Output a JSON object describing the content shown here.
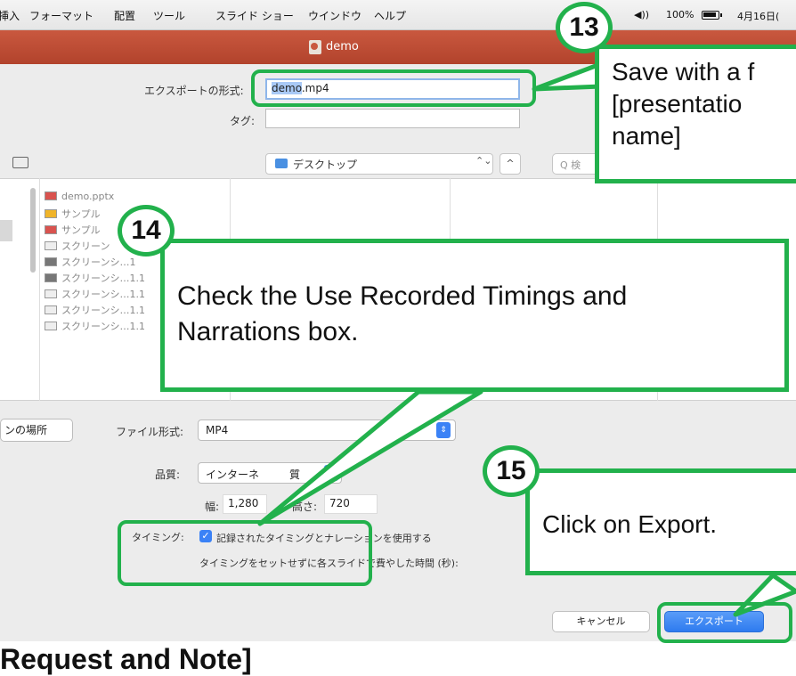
{
  "menubar": {
    "items": [
      "挿入",
      "フォーマット",
      "配置",
      "ツール",
      "スライド ショー",
      "ウインドウ",
      "ヘルプ"
    ],
    "volume": "◀))",
    "battery_percent": "100%",
    "date": "4月16日("
  },
  "window": {
    "title": "demo"
  },
  "export": {
    "export_as_label": "エクスポートの形式:",
    "filename_selected": "demo",
    "filename_ext": ".mp4",
    "tags_label": "タグ:",
    "tags_value": "",
    "location": "デスクトップ",
    "updown_icon": "⌃⌄",
    "expand_icon": "^",
    "search_placeholder": "Q 検"
  },
  "files": [
    {
      "name": "demo.pptx",
      "icon_color": "#d9534f"
    },
    {
      "name": "サンプル",
      "icon_color": "#f0b429"
    },
    {
      "name": "サンプル",
      "icon_color": "#d9534f"
    },
    {
      "name": "スクリーン",
      "icon_color": "#eeeeee"
    },
    {
      "name": "スクリーンシ…1",
      "icon_color": "#777777"
    },
    {
      "name": "スクリーンシ…1.1",
      "icon_color": "#777777"
    },
    {
      "name": "スクリーンシ…1.1",
      "icon_color": "#eeeeee"
    },
    {
      "name": "スクリーンシ…1.1",
      "icon_color": "#eeeeee"
    },
    {
      "name": "スクリーンシ…1.1",
      "icon_color": "#eeeeee"
    }
  ],
  "options": {
    "location_button": "ンの場所",
    "file_format_label": "ファイル形式:",
    "file_format_value": "MP4",
    "quality_label": "品質:",
    "quality_value": "インターネ",
    "quality_value_tail": "質",
    "width_label": "幅:",
    "width_value": "1,280",
    "height_label": "高さ:",
    "height_value": "720",
    "timing_label": "タイミング:",
    "timing_checkbox_label": "記録されたタイミングとナレーションを使用する",
    "timing_checked": true,
    "timing_seconds_label": "タイミングをセットせずに各スライドで費やした時間 (秒):"
  },
  "buttons": {
    "cancel": "キャンセル",
    "export": "エクスポート"
  },
  "heading": "Request and Note]",
  "annotations": {
    "step13": {
      "number": "13",
      "text_line1": "Save with a f",
      "text_line2": "[presentatio",
      "text_line3": "name]"
    },
    "step14": {
      "number": "14",
      "text_line1": "Check the Use Recorded Timings and",
      "text_line2": "Narrations box."
    },
    "step15": {
      "number": "15",
      "text": "Click on Export."
    },
    "accent_color": "#22b14c"
  }
}
